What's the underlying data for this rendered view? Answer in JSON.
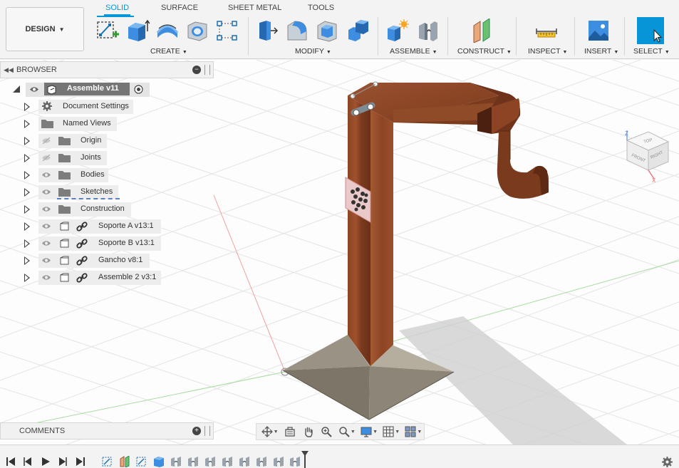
{
  "workspace": {
    "label": "DESIGN"
  },
  "tabs": [
    {
      "label": "SOLID",
      "active": true
    },
    {
      "label": "SURFACE",
      "active": false
    },
    {
      "label": "SHEET METAL",
      "active": false
    },
    {
      "label": "TOOLS",
      "active": false
    }
  ],
  "toolbar_groups": {
    "create": "CREATE",
    "modify": "MODIFY",
    "assemble": "ASSEMBLE",
    "construct": "CONSTRUCT",
    "inspect": "INSPECT",
    "insert": "INSERT",
    "select": "SELECT"
  },
  "browser": {
    "title": "BROWSER",
    "root": "Assemble v11",
    "items": [
      {
        "label": "Document Settings",
        "icon": "gear-icon"
      },
      {
        "label": "Named Views",
        "icon": "folder-icon"
      },
      {
        "label": "Origin",
        "icon": "folder-icon",
        "hidden": true
      },
      {
        "label": "Joints",
        "icon": "folder-icon",
        "hidden": true
      },
      {
        "label": "Bodies",
        "icon": "folder-icon"
      },
      {
        "label": "Sketches",
        "icon": "folder-icon"
      },
      {
        "label": "Construction",
        "icon": "folder-icon"
      },
      {
        "label": "Soporte A v13:1",
        "icon": "component-link-icon"
      },
      {
        "label": "Soporte B v13:1",
        "icon": "component-link-icon"
      },
      {
        "label": "Gancho v8:1",
        "icon": "component-link-icon"
      },
      {
        "label": "Assemble 2 v3:1",
        "icon": "component-link-icon"
      }
    ]
  },
  "comments": {
    "title": "COMMENTS"
  },
  "viewcube": {
    "top": "TOP",
    "front": "FRONT",
    "right": "RIGHT",
    "x": "X",
    "z": "Z"
  },
  "colors": {
    "accent": "#0696d7",
    "wood": "#7a3a1e",
    "base": "#8b8477",
    "select_tile": "#0696d7"
  }
}
